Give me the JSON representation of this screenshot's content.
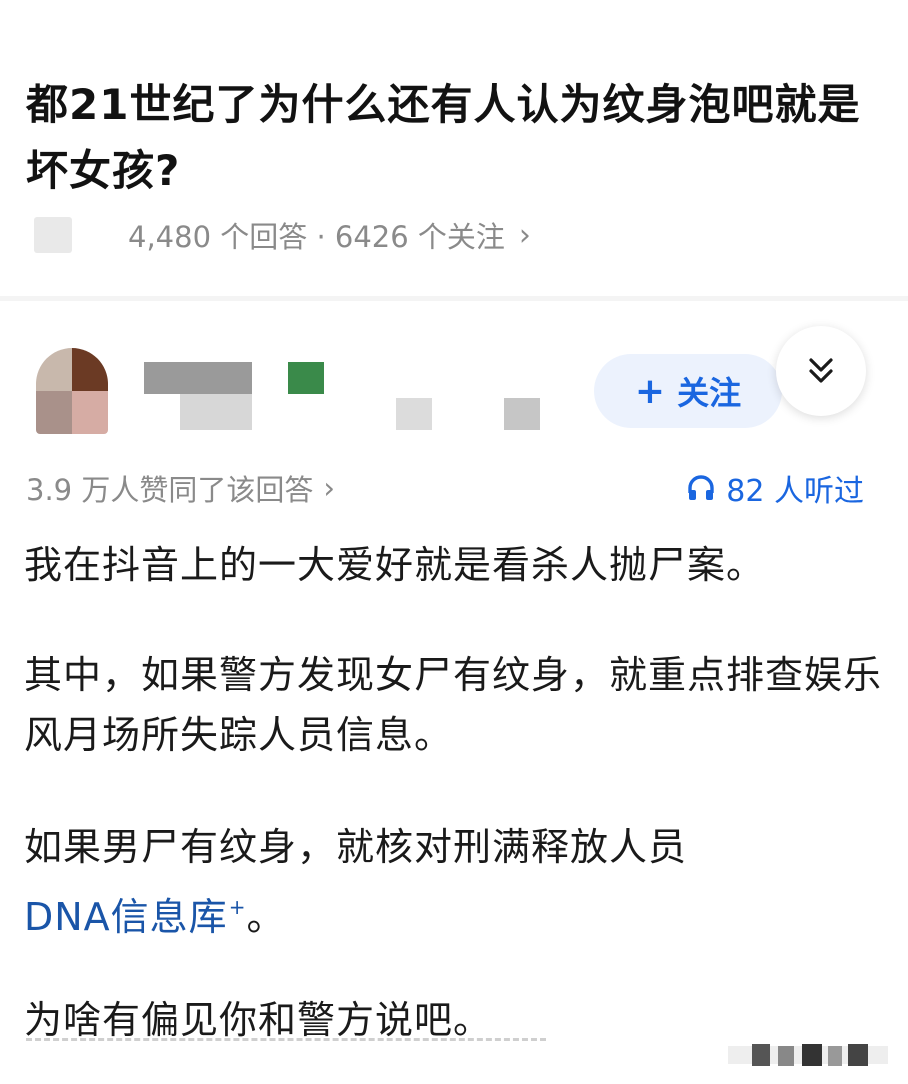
{
  "question": {
    "title": "都21世纪了为什么还有人认为纹身泡吧就是坏女孩?",
    "meta": "4,480 个回答 · 6426 个关注",
    "chevron": "›"
  },
  "author": {
    "follow_plus": "+",
    "follow_label": "关注",
    "expand_icon": "double-chevron-down-icon"
  },
  "answer": {
    "votes": "3.9 万人赞同了该回答",
    "vote_chevron": "›",
    "listen_count": "82 人听过",
    "paragraphs": [
      "我在抖音上的一大爱好就是看杀人抛尸案。",
      "其中，如果警方发现女尸有纹身，就重点排查娱乐风月场所失踪人员信息。",
      "如果男尸有纹身，就核对刑满释放人员",
      "为啥有偏见你和警方说吧。"
    ],
    "link_text": "DNA信息库",
    "link_mark": "+",
    "after_link": "。"
  },
  "colors": {
    "accent": "#1a66e0",
    "link": "#1a55a8",
    "follow_bg": "#ecf2fd",
    "meta_text": "#8a8a8a"
  }
}
